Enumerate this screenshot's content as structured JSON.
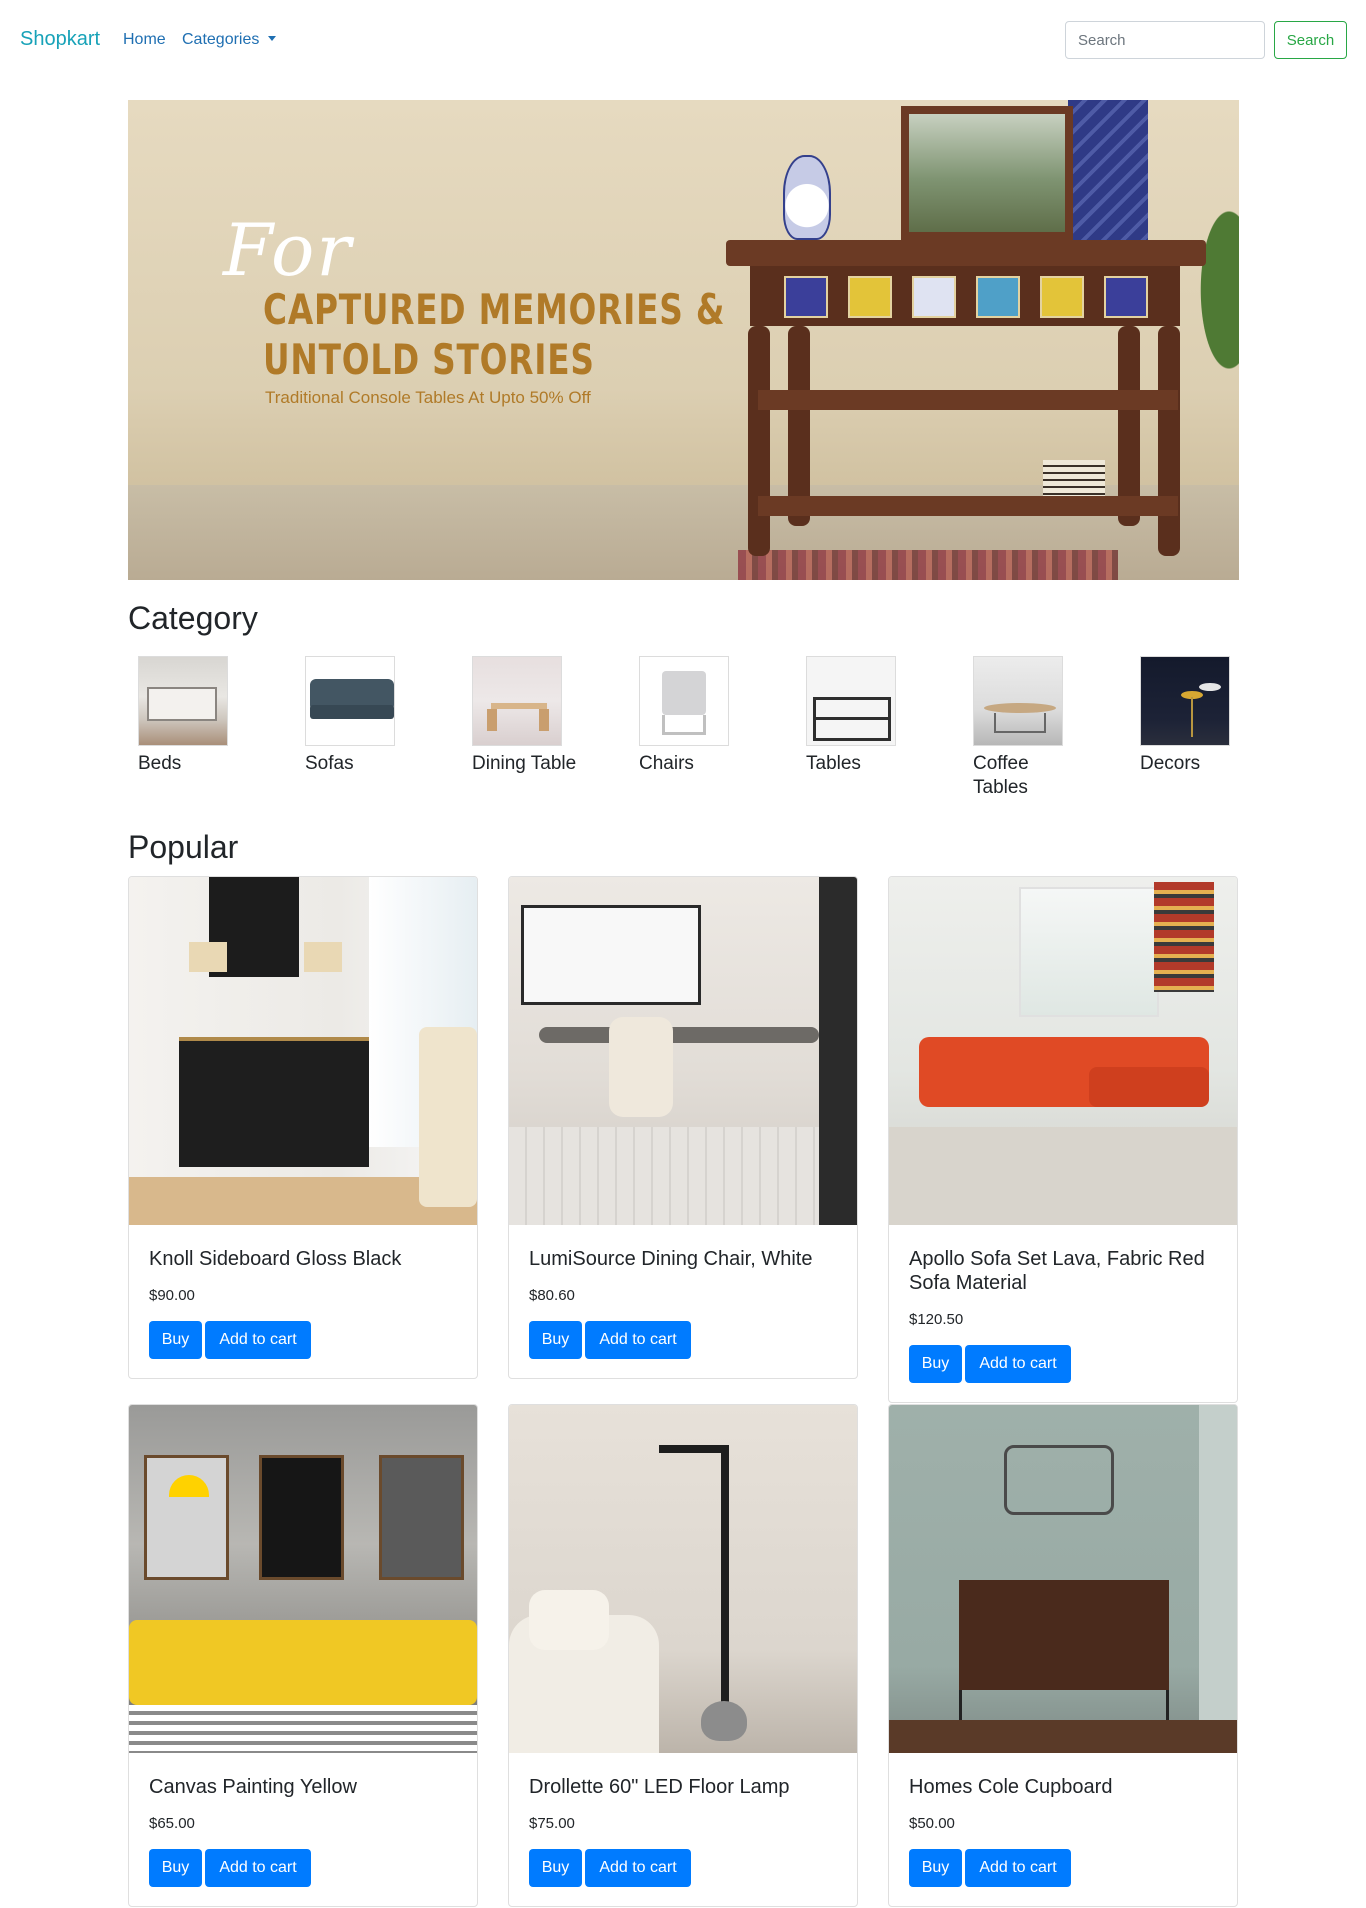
{
  "navbar": {
    "brand": "Shopkart",
    "home": "Home",
    "categories": "Categories",
    "search_placeholder": "Search",
    "search_button": "Search"
  },
  "banner": {
    "script": "For",
    "line1": "CAPTURED MEMORIES &",
    "line2": "UNTOLD STORIES",
    "subline": "Traditional Console Tables At Upto 50% Off"
  },
  "category": {
    "title": "Category",
    "items": [
      {
        "label": "Beds"
      },
      {
        "label": "Sofas"
      },
      {
        "label": "Dining Table"
      },
      {
        "label": "Chairs"
      },
      {
        "label": "Tables"
      },
      {
        "label": "Coffee Tables"
      },
      {
        "label": "Decors"
      }
    ]
  },
  "popular": {
    "title": "Popular",
    "buy_label": "Buy",
    "cart_label": "Add to cart",
    "products": [
      {
        "name": "Knoll Sideboard Gloss Black",
        "price": "$90.00"
      },
      {
        "name": "LumiSource Dining Chair, White",
        "price": "$80.60"
      },
      {
        "name": "Apollo Sofa Set Lava, Fabric Red Sofa Material",
        "price": "$120.50"
      },
      {
        "name": "Canvas Painting Yellow",
        "price": "$65.00"
      },
      {
        "name": "Drollette 60\" LED Floor Lamp",
        "price": "$75.00"
      },
      {
        "name": "Homes Cole Cupboard",
        "price": "$50.00"
      }
    ]
  },
  "colors": {
    "brand": "#17a2b8",
    "primary": "#007bff",
    "success": "#28a745"
  }
}
